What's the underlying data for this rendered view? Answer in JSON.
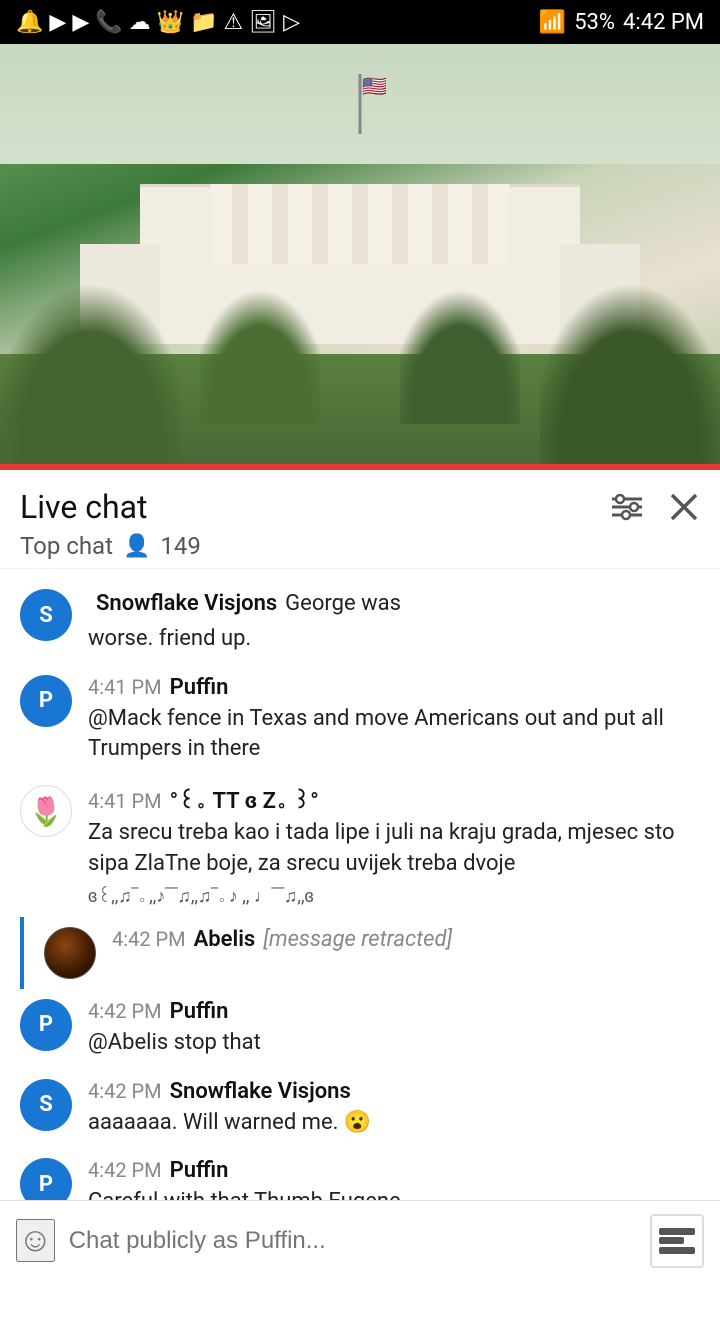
{
  "statusBar": {
    "time": "4:42 PM",
    "battery": "53%",
    "icons": [
      "notification",
      "youtube",
      "youtube",
      "phone",
      "cloud",
      "crown",
      "folder",
      "warning",
      "image",
      "play"
    ]
  },
  "header": {
    "liveChatLabel": "Live chat",
    "topChatLabel": "Top chat",
    "viewerCount": "149",
    "filterIconLabel": "filter-icon",
    "closeIconLabel": "close-icon"
  },
  "messages": [
    {
      "id": 1,
      "avatarType": "s",
      "avatarLabel": "S",
      "time": "",
      "author": "Snowflake Visjons",
      "text": "George was worse. friend up.",
      "partial": true
    },
    {
      "id": 2,
      "avatarType": "p",
      "avatarLabel": "P",
      "time": "4:41 PM",
      "author": "Puffin",
      "text": "@Mack fence in Texas and move Americans out and put all Trumpers in there"
    },
    {
      "id": 3,
      "avatarType": "tulip",
      "avatarLabel": "🌷",
      "time": "4:41 PM",
      "author": "°꒰。TT ɞ Z。꒱°",
      "text": "Za srecu treba kao i tada lipe i juli na kraju grada, mjesec sto sipa ZlaTne boje, za srecu uvijek treba dvoje",
      "music": "ɞ꒰,,♫‾｡ ,,♪‾‾♫,,♫‾｡ ♪ ,, ♩‾‾♫,,ɞ"
    },
    {
      "id": 4,
      "avatarType": "dark",
      "avatarLabel": "",
      "time": "4:42 PM",
      "author": "Abelis",
      "text": "[message retracted]",
      "retracted": true
    },
    {
      "id": 5,
      "avatarType": "p",
      "avatarLabel": "P",
      "time": "4:42 PM",
      "author": "Puffin",
      "text": "@Abelis stop that"
    },
    {
      "id": 6,
      "avatarType": "s",
      "avatarLabel": "S",
      "time": "4:42 PM",
      "author": "Snowflake Visjons",
      "text": "aaaaaaa. Will warned me. 😮"
    },
    {
      "id": 7,
      "avatarType": "p",
      "avatarLabel": "P",
      "time": "4:42 PM",
      "author": "Puffin",
      "text": "Careful with that Thumb Eugene"
    }
  ],
  "inputBar": {
    "placeholder": "Chat publicly as Puffin...",
    "emojiLabel": "☺",
    "superChatLabel": "super-chat"
  }
}
